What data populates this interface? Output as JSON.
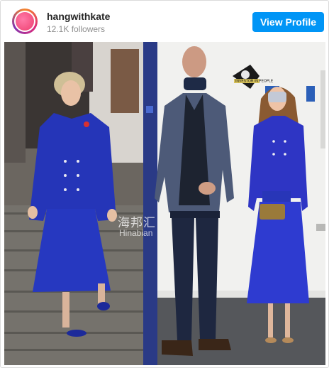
{
  "profile": {
    "username": "hangwithkate",
    "followers": "12.1K followers",
    "view_button": "View Profile"
  },
  "photo": {
    "watermark": "海邦汇",
    "watermark_sub": "Hinabian",
    "plaque_text": "INVESTOR IN PEOPLE"
  },
  "colors": {
    "accent": "#0095f6",
    "royal_blue": "#2535b8"
  }
}
